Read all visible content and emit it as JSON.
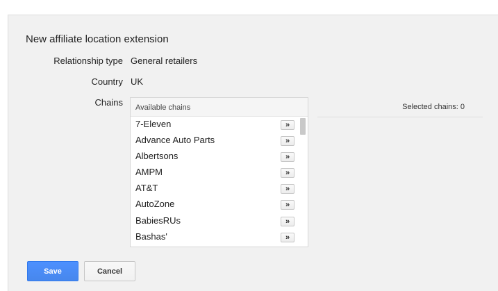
{
  "dialog": {
    "title": "New affiliate location extension"
  },
  "fields": {
    "relationship_type": {
      "label": "Relationship type",
      "value": "General retailers"
    },
    "country": {
      "label": "Country",
      "value": "UK"
    },
    "chains": {
      "label": "Chains"
    }
  },
  "available_chains": {
    "header": "Available chains",
    "add_label": "»",
    "items": [
      {
        "name": "7-Eleven"
      },
      {
        "name": "Advance Auto Parts"
      },
      {
        "name": "Albertsons"
      },
      {
        "name": "AMPM"
      },
      {
        "name": "AT&T"
      },
      {
        "name": "AutoZone"
      },
      {
        "name": "BabiesRUs"
      },
      {
        "name": "Bashas'"
      }
    ]
  },
  "selected_chains": {
    "label": "Selected chains: 0"
  },
  "actions": {
    "save_label": "Save",
    "cancel_label": "Cancel"
  },
  "colors": {
    "primary_button": "#4d90fe",
    "panel_background": "#f1f1f1"
  }
}
